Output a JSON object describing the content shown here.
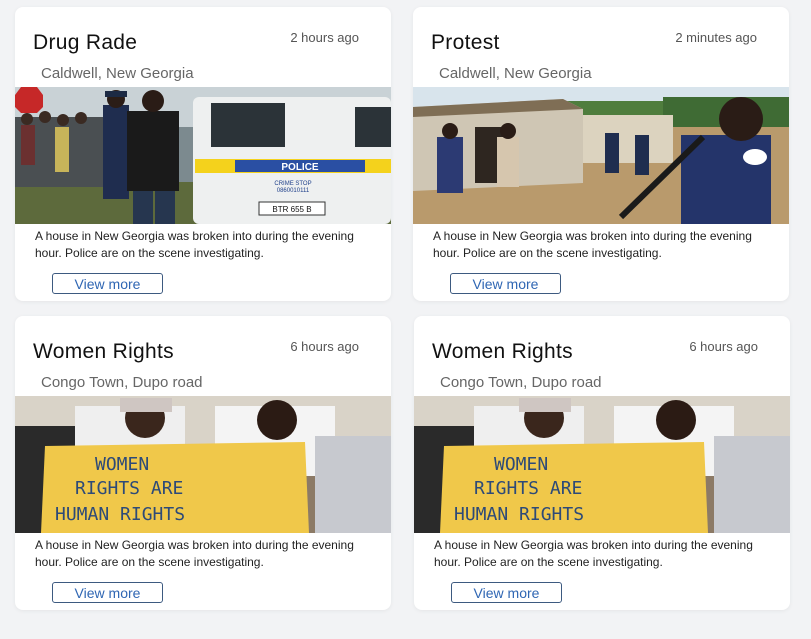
{
  "cards": [
    {
      "title": "Drug Rade",
      "time": "2 hours ago",
      "location": "Caldwell, New Georgia",
      "description": "A house in New Georgia was broken into during the evening hour. Police are on the scene investigating.",
      "button_label": "View more",
      "image_alt": "Police officers arresting a man beside a white police vehicle"
    },
    {
      "title": "Protest",
      "time": "2 minutes ago",
      "location": "Caldwell, New Georgia",
      "description": "A house in New Georgia was broken into during the evening hour. Police are on the scene investigating.",
      "button_label": "View more",
      "image_alt": "Armed officers in blue uniforms outside a small building"
    },
    {
      "title": "Women Rights",
      "time": "6 hours ago",
      "location": "Congo Town, Dupo road",
      "description": "A house in New Georgia was broken into during the evening hour. Police are on the scene investigating.",
      "button_label": "View more",
      "image_alt": "Women holding a handwritten protest sign",
      "sign_text": [
        "WOMEN",
        "RIGHTS ARE",
        "HUMAN RIGHTS"
      ]
    },
    {
      "title": "Women Rights",
      "time": "6 hours ago",
      "location": "Congo Town, Dupo road",
      "description": "A house in New Georgia was broken into during the evening hour. Police are on the scene investigating.",
      "button_label": "View more",
      "image_alt": "Women holding a handwritten protest sign",
      "sign_text": [
        "WOMEN",
        "RIGHTS ARE",
        "HUMAN RIGHTS"
      ]
    }
  ],
  "photo_labels": {
    "police_sign": "POLICE",
    "crime_stop": "CRIME STOP",
    "phone": "0860010111",
    "plate": "BTR 655 B"
  },
  "colors": {
    "page_background": "#f2f3f5",
    "card_background": "#ffffff",
    "button_text": "#2f66b3",
    "button_border": "#3d5a80"
  }
}
